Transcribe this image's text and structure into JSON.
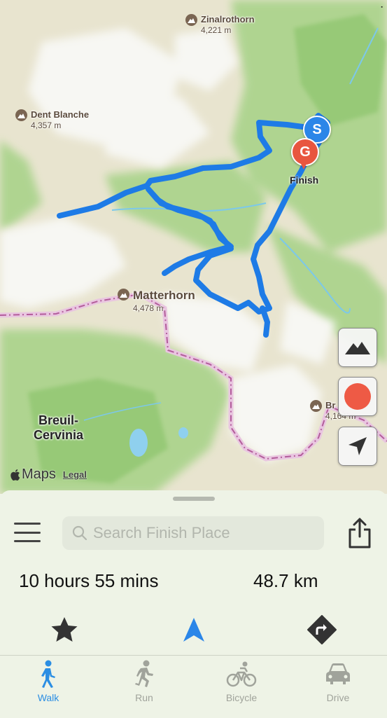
{
  "map": {
    "peaks": [
      {
        "name": "Zinalrothorn",
        "elevation": "4,221 m"
      },
      {
        "name": "Dent Blanche",
        "elevation": "4,357 m"
      },
      {
        "name": "Matterhorn",
        "elevation": "4,478 m"
      },
      {
        "name": "Br",
        "elevation": "4,164 m"
      }
    ],
    "town": {
      "line1": "Breuil-",
      "line2": "Cervinia"
    },
    "start_marker": "S",
    "goal_marker": "G",
    "finish_label": "Finish",
    "brand": "Maps",
    "legal": "Legal",
    "route_color": "#1e7be6",
    "goal_color": "#e8563f",
    "start_color": "#2b86e8"
  },
  "map_controls": {
    "terrain_icon": "mountain-icon",
    "record_icon": "record-icon",
    "locate_icon": "location-arrow-icon"
  },
  "sheet": {
    "search_placeholder": "Search Finish Place",
    "duration": "10 hours 55 mins",
    "distance": "48.7 km",
    "actions": [
      "star-icon",
      "navigation-arrow-icon",
      "directions-icon"
    ]
  },
  "tabs": [
    {
      "label": "Walk",
      "icon": "walk-icon",
      "active": true
    },
    {
      "label": "Run",
      "icon": "run-icon",
      "active": false
    },
    {
      "label": "Bicycle",
      "icon": "bicycle-icon",
      "active": false
    },
    {
      "label": "Drive",
      "icon": "car-icon",
      "active": false
    }
  ]
}
